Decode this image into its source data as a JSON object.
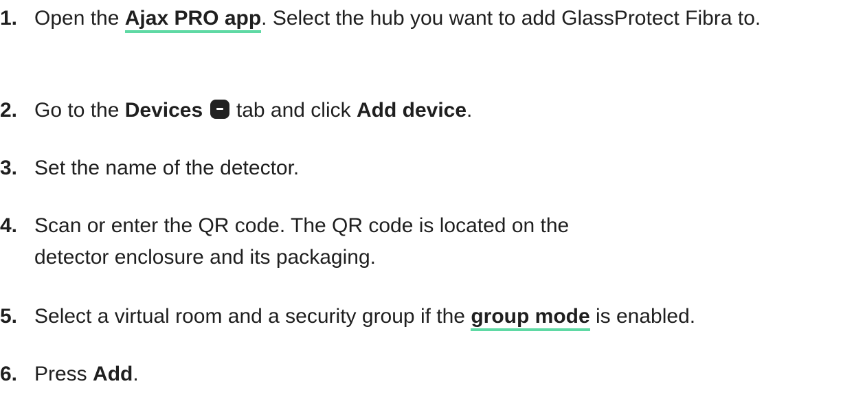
{
  "steps": [
    {
      "num": "1.",
      "pre": "Open the ",
      "link": "Ajax PRO app",
      "post": ". Select the hub you want to add GlassProtect Fibra to."
    },
    {
      "num": "2.",
      "pre": "Go to the ",
      "bold1": "Devices",
      "icon": "devices-tab-icon",
      "mid": " tab and click ",
      "bold2": "Add device",
      "post": "."
    },
    {
      "num": "3.",
      "text": "Set the name of the detector."
    },
    {
      "num": "4.",
      "text": "Scan or enter the QR code. The QR code is located on the detector enclosure and its packaging."
    },
    {
      "num": "5.",
      "pre": "Select a virtual room and a security group if the ",
      "link": "group mode",
      "post": " is enabled."
    },
    {
      "num": "6.",
      "pre": "Press ",
      "bold": "Add",
      "post": "."
    }
  ],
  "colors": {
    "link_underline": "#5fd9a4",
    "text": "#1f1f1f"
  }
}
